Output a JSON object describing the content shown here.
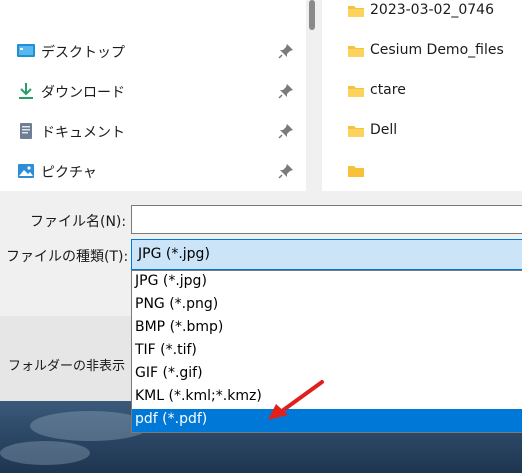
{
  "quick_access": [
    {
      "label": "デスクトップ",
      "icon": "desktop-icon"
    },
    {
      "label": "ダウンロード",
      "icon": "download-icon"
    },
    {
      "label": "ドキュメント",
      "icon": "document-icon"
    },
    {
      "label": "ピクチャ",
      "icon": "pictures-icon"
    }
  ],
  "folders": [
    {
      "label": "2023-03-02_0746"
    },
    {
      "label": "Cesium Demo_files"
    },
    {
      "label": "ctare"
    },
    {
      "label": "Dell"
    }
  ],
  "form": {
    "filename_label": "ファイル名(N):",
    "filename_value": "",
    "filetype_label": "ファイルの種類(T):",
    "filetype_selected": "JPG (*.jpg)"
  },
  "hide_folders_label": "フォルダーの非表示",
  "filetype_options": [
    {
      "label": "JPG (*.jpg)"
    },
    {
      "label": "PNG (*.png)"
    },
    {
      "label": "BMP (*.bmp)"
    },
    {
      "label": "TIF (*.tif)"
    },
    {
      "label": "GIF (*.gif)"
    },
    {
      "label": "KML (*.kml;*.kmz)"
    },
    {
      "label": "pdf (*.pdf)"
    }
  ],
  "highlighted_option": "pdf (*.pdf)",
  "colors": {
    "selection": "#0078d7",
    "select_field": "#cce4f7",
    "folder": "#f8c13a",
    "arrow": "#e0201b"
  }
}
